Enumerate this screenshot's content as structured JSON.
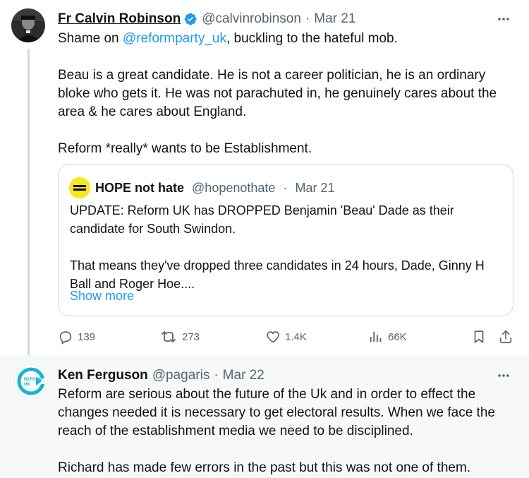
{
  "tweets": [
    {
      "author_name": "Fr Calvin Robinson",
      "handle": "@calvinrobinson",
      "separator": "·",
      "date": "Mar 21",
      "verified": true,
      "body": {
        "p1_prefix": "Shame on ",
        "p1_mention": "@reformparty_uk",
        "p1_suffix": ", buckling to the hateful mob.",
        "p2": "Beau is a great candidate. He is not a career politician, he is an ordinary bloke who gets it. He was not parachuted in, he genuinely cares about the area & he cares about England.",
        "p3": "Reform *really* wants to be Establishment."
      },
      "quote": {
        "author_name": "HOPE not hate",
        "handle": "@hopenothate",
        "separator": "·",
        "date": "Mar 21",
        "p1": "UPDATE: Reform UK has DROPPED Benjamin 'Beau' Dade as their candidate for South Swindon.",
        "p2": "That means they've dropped three candidates in 24 hours, Dade, Ginny H Ball and Roger Hoe....",
        "show_more": "Show more"
      },
      "actions": {
        "replies": "139",
        "reposts": "273",
        "likes": "1.4K",
        "views": "66K"
      }
    },
    {
      "author_name": "Ken Ferguson",
      "handle": "@pagaris",
      "separator": "·",
      "date": "Mar 22",
      "avatar_text": "REFORM UK",
      "body": {
        "p1": "Reform are serious about the future of the Uk and in order to effect the changes needed it is necessary to get electoral results.  When we face the reach of the establishment media we need to be disciplined.",
        "p2": "Richard has made few errors in the past but this was not one of them."
      }
    }
  ],
  "icons": {
    "reply": "reply-icon",
    "repost": "repost-icon",
    "like": "heart-icon",
    "views": "views-icon",
    "bookmark": "bookmark-icon",
    "share": "share-icon",
    "more": "more-icon",
    "verified": "verified-badge-icon"
  },
  "colors": {
    "accent": "#1d9bf0",
    "muted": "#536471",
    "text": "#0f1419",
    "reform_blue": "#12b6cf"
  }
}
